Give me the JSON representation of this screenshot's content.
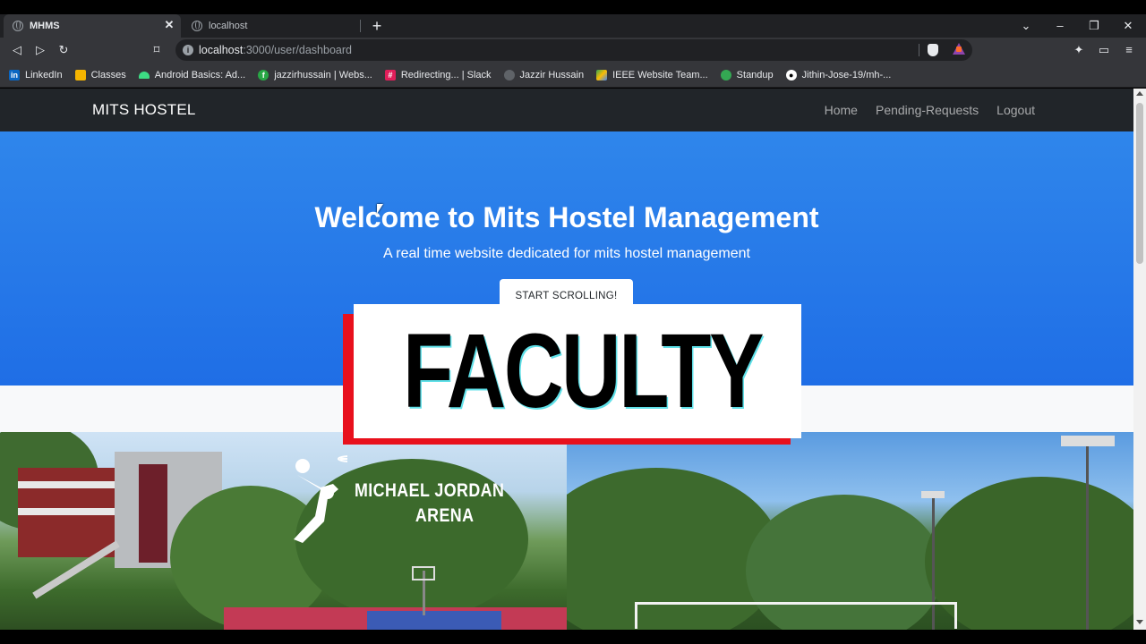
{
  "browser": {
    "tabs": [
      {
        "title": "MHMS",
        "active": true
      },
      {
        "title": "localhost",
        "active": false
      }
    ],
    "url_host": "localhost",
    "url_path": ":3000/user/dashboard",
    "bookmarks": [
      {
        "label": "LinkedIn",
        "icon": "linkedin-icon",
        "color": "#0a66c2"
      },
      {
        "label": "Classes",
        "icon": "classroom-icon",
        "color": "#f4b400"
      },
      {
        "label": "Android Basics: Ad...",
        "icon": "android-icon",
        "color": "#3ddc84"
      },
      {
        "label": "jazzirhussain | Webs...",
        "icon": "site-icon",
        "color": "#28a745"
      },
      {
        "label": "Redirecting... | Slack",
        "icon": "slack-icon",
        "color": "#e01e5a"
      },
      {
        "label": "Jazzir Hussain",
        "icon": "globe-icon",
        "color": "#9aa0a6"
      },
      {
        "label": "IEEE Website Team...",
        "icon": "drive-icon",
        "color": "#fbbc04"
      },
      {
        "label": "Standup",
        "icon": "standup-icon",
        "color": "#34a853"
      },
      {
        "label": "Jithin-Jose-19/mh-...",
        "icon": "github-icon",
        "color": "#ffffff"
      }
    ]
  },
  "site": {
    "brand": "MITS HOSTEL",
    "nav": [
      "Home",
      "Pending-Requests",
      "Logout"
    ],
    "hero_title": "Welcome to Mits Hostel Management",
    "hero_subtitle": "A real time website dedicated for mits hostel management",
    "hero_button": "START SCROLLING!"
  },
  "overlay": {
    "text": "FACULTY"
  },
  "photos": {
    "arena_line1": "MICHAEL JORDAN",
    "arena_line2": "ARENA"
  },
  "colors": {
    "navbar": "#212529",
    "hero": "#1f6ee6",
    "overlay_accent": "#e8101c"
  }
}
